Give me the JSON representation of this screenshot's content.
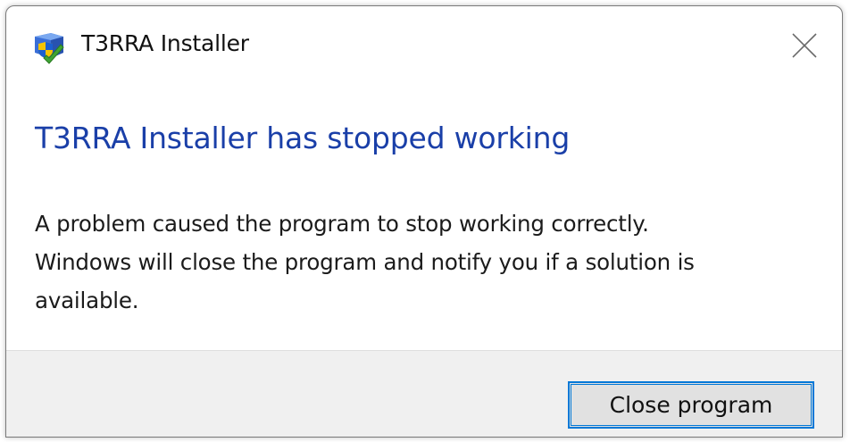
{
  "window": {
    "title": "T3RRA Installer",
    "icon": "installer-shield-icon",
    "close_icon": "close-icon"
  },
  "content": {
    "headline": "T3RRA Installer has stopped working",
    "message_lines": [
      "A problem caused the program to stop working correctly.",
      "Windows will close the program and notify you if a solution is",
      "available."
    ]
  },
  "footer": {
    "close_program_label": "Close program"
  },
  "colors": {
    "headline": "#1a3fa8",
    "footer_bg": "#f0f0f0",
    "button_bg": "#e1e1e1",
    "button_border": "#0078d7"
  }
}
